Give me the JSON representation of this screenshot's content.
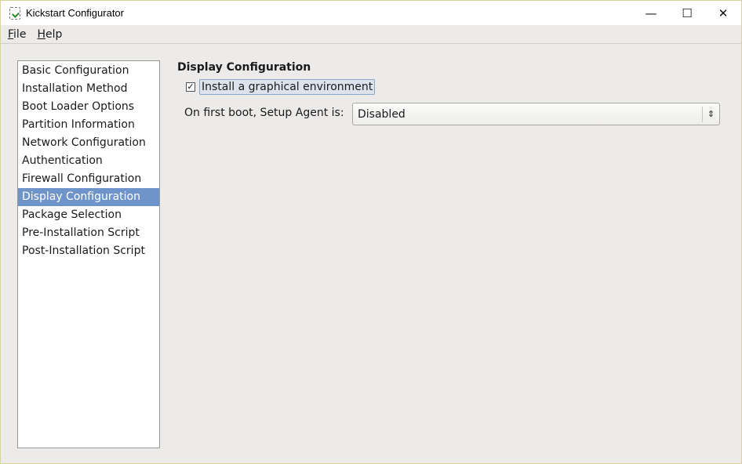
{
  "window": {
    "title": "Kickstart Configurator",
    "controls": {
      "minimize": "—",
      "maximize": "☐",
      "close": "✕"
    }
  },
  "menu": [
    {
      "label": "File",
      "mnemonic": "F",
      "rest": "ile"
    },
    {
      "label": "Help",
      "mnemonic": "H",
      "rest": "elp"
    }
  ],
  "sidebar": {
    "selected": "Display Configuration",
    "items": [
      "Basic Configuration",
      "Installation Method",
      "Boot Loader Options",
      "Partition Information",
      "Network Configuration",
      "Authentication",
      "Firewall Configuration",
      "Display Configuration",
      "Package Selection",
      "Pre-Installation Script",
      "Post-Installation Script"
    ]
  },
  "main": {
    "title": "Display Configuration",
    "graphical_checkbox": {
      "label": "Install a graphical environment",
      "checked": true,
      "mark": "✓"
    },
    "setup_agent": {
      "label": "On first boot, Setup Agent is:",
      "value": "Disabled",
      "arrow": "⌃⌄"
    }
  },
  "colors": {
    "selection": "#6f94c9"
  }
}
